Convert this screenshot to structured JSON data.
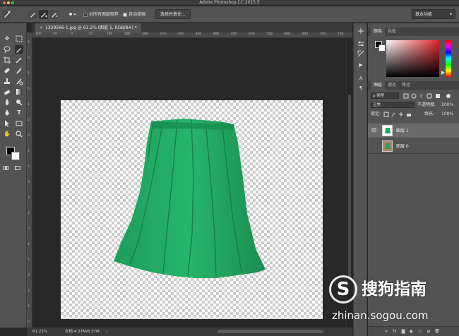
{
  "window": {
    "title": "Adobe Photoshop CC 2015.5",
    "traffic_colors": [
      "#ff5f57",
      "#febc2e",
      "#28c840"
    ]
  },
  "options_bar": {
    "sample_all_layers": "对所有图层取样",
    "sample_all_layers_checked": false,
    "auto_enhance": "自动增强",
    "auto_enhance_checked": true,
    "select_and_mask": "选择并遮住...",
    "workspace": "基本功能"
  },
  "document": {
    "tab_label": "1329566-1.jpg @ 61.2% (图层 1, RGB/8#) *",
    "ruler_h_labels": [
      "100",
      "50",
      "0",
      "50",
      "100",
      "150",
      "200",
      "250",
      "300",
      "350",
      "400",
      "450",
      "500",
      "550",
      "600",
      "650",
      "700",
      "750"
    ],
    "ruler_v_labels": [
      "5",
      "0",
      "5",
      "0",
      "1",
      "5",
      "0",
      "2",
      "5",
      "0",
      "3",
      "5",
      "0",
      "4",
      "5",
      "0",
      "5",
      "5",
      "0"
    ]
  },
  "status_bar": {
    "zoom": "61.23%",
    "doc_info": "文档:4.37M/8.37M"
  },
  "color_panel": {
    "tabs": [
      "颜色",
      "色板"
    ],
    "foreground": "#000000",
    "background": "#ffffff",
    "hue_color": "#e3232c"
  },
  "layers_panel": {
    "tabs": [
      "图层",
      "通道",
      "路径"
    ],
    "filter_kind": "ρ 类型",
    "blend_mode": "正常",
    "opacity_label": "不透明度:",
    "opacity_value": "100%",
    "lock_label": "锁定:",
    "fill_label": "填充:",
    "fill_value": "100%",
    "layers": [
      {
        "name": "图层 1",
        "visible": true,
        "selected": true
      },
      {
        "name": "图层 0",
        "visible": false,
        "selected": false
      }
    ]
  },
  "watermark": {
    "logo_letter": "S",
    "brand": "搜狗指南",
    "url": "zhinan.sogou.com"
  },
  "icons": {
    "tools": [
      "move-icon",
      "marquee-icon",
      "lasso-icon",
      "quick-select-icon",
      "crop-icon",
      "eyedropper-icon",
      "healing-icon",
      "brush-icon",
      "stamp-icon",
      "history-brush-icon",
      "eraser-icon",
      "gradient-icon",
      "blur-icon",
      "dodge-icon",
      "pen-icon",
      "type-icon",
      "path-select-icon",
      "shape-icon",
      "hand-icon",
      "zoom-icon"
    ]
  }
}
